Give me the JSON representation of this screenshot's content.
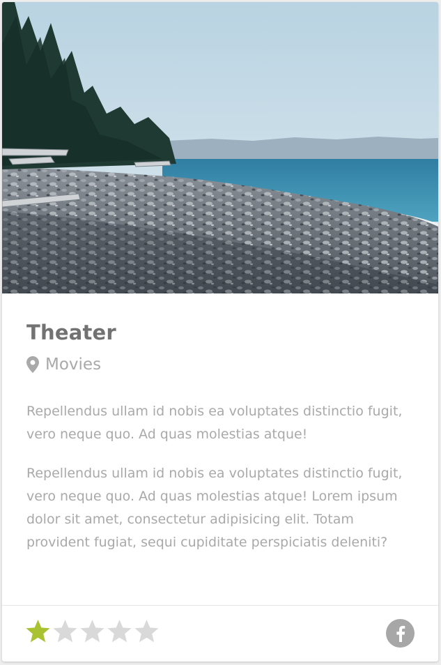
{
  "card": {
    "title": "Theater",
    "location_label": "Movies",
    "location_icon": "map-pin-icon",
    "description_1": "Repellendus ullam id nobis ea voluptates distinctio fugit, vero neque quo. Ad quas molestias atque!",
    "description_2": "Repellendus ullam id nobis ea voluptates distinctio fugit, vero neque quo. Ad quas molestias atque! Lorem ipsum dolor sit amet, consectetur adipisicing elit. Totam provident fugiat, sequi cupiditate perspiciatis deleniti?",
    "rating": {
      "value": 1,
      "max": 5
    },
    "share_icon": "facebook-icon",
    "colors": {
      "star_filled": "#a8c232",
      "star_empty": "#d9d9d9",
      "social_icon": "#a7a7a7"
    }
  }
}
